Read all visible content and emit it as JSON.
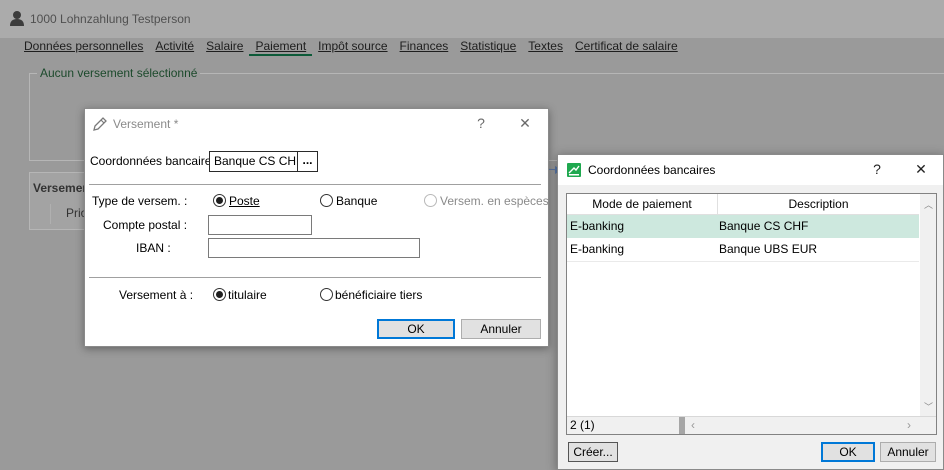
{
  "main": {
    "title": "1000 Lohnzahlung Testperson",
    "tabs": [
      "Données personnelles",
      "Activité",
      "Salaire",
      "Paiement",
      "Impôt source",
      "Finances",
      "Statistique",
      "Textes",
      "Certificat de salaire"
    ],
    "group_title": "Aucun versement sélectionné",
    "section_label": "Versemen",
    "column_prio": "Prio"
  },
  "versement": {
    "title": "Versement *",
    "help": "?",
    "close": "✕",
    "coord_label": "Coordonnées bancaires :",
    "coord_value": "Banque CS CHF (",
    "browse": "...",
    "type_label": "Type de versem. :",
    "opt_poste": "Poste",
    "opt_banque": "Banque",
    "opt_especes": "Versem. en espèces",
    "compte_label": "Compte postal :",
    "iban_label": "IBAN :",
    "versement_a_label": "Versement à :",
    "opt_titulaire": "titulaire",
    "opt_tiers": "bénéficiaire tiers",
    "ok": "OK",
    "cancel": "Annuler"
  },
  "coord": {
    "title": "Coordonnées bancaires",
    "help": "?",
    "close": "✕",
    "columns": [
      "Mode de paiement",
      "Description"
    ],
    "rows": [
      {
        "mode": "E-banking",
        "desc": "Banque CS CHF"
      },
      {
        "mode": "E-banking",
        "desc": "Banque UBS EUR"
      }
    ],
    "count": "2 (1)",
    "create": "Créer...",
    "ok": "OK",
    "cancel": "Annuler",
    "accent": "#cde8de"
  }
}
